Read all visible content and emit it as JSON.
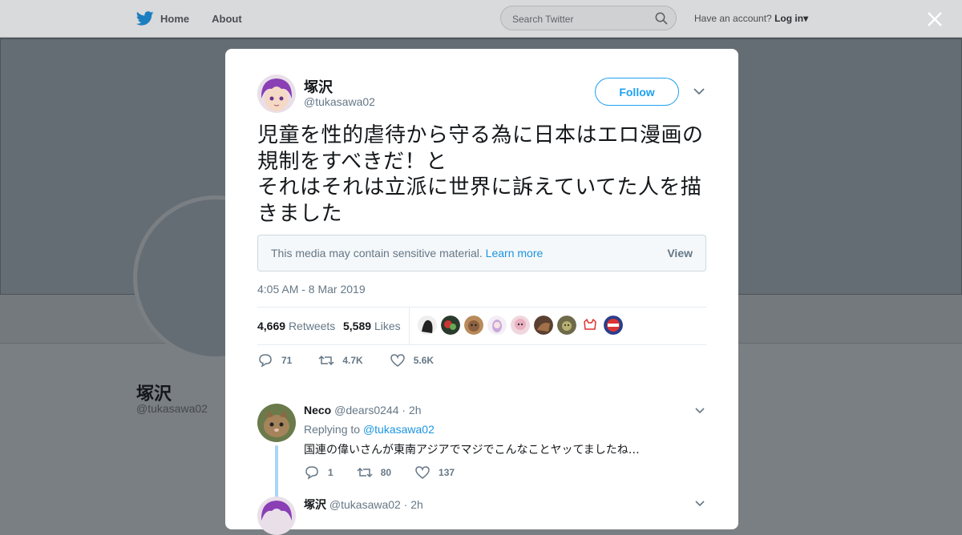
{
  "topbar": {
    "nav": [
      {
        "label": "Home",
        "icon": "twitter-bird-icon"
      },
      {
        "label": "About"
      }
    ],
    "search_placeholder": "Search Twitter",
    "account_prompt": "Have an account?",
    "login_label": "Log in"
  },
  "background_profile": {
    "name": "塚沢",
    "handle": "@tukasawa02"
  },
  "tweet": {
    "author_name": "塚沢",
    "author_handle": "@tukasawa02",
    "follow_label": "Follow",
    "text": "児童を性的虐待から守る為に日本はエロ漫画の規制をすべきだ！と\nそれはそれは立派に世界に訴えていてた人を描きました",
    "sensitive_notice": "This media may contain sensitive material.",
    "learn_more": "Learn more",
    "view_label": "View",
    "timestamp": "4:05 AM - 8 Mar 2019",
    "retweets_count": "4,669",
    "retweets_label": "Retweets",
    "likes_count": "5,589",
    "likes_label": "Likes",
    "actions": {
      "replies": "71",
      "retweets": "4.7K",
      "likes": "5.6K"
    }
  },
  "replies": [
    {
      "name": "Neco",
      "handle": "@dears0244",
      "time": "· 2h",
      "replying_label": "Replying to",
      "replying_to": "@tukasawa02",
      "text": "国連の偉いさんが東南アジアでマジでこんなことヤッてましたね…",
      "actions": {
        "replies": "1",
        "retweets": "80",
        "likes": "137"
      }
    },
    {
      "name": "塚沢",
      "handle": "@tukasawa02",
      "time": "· 2h"
    }
  ],
  "colors": {
    "accent": "#1da1f2",
    "link": "#1b95e0",
    "muted": "#657786",
    "thread_line": "#aad4f5"
  }
}
